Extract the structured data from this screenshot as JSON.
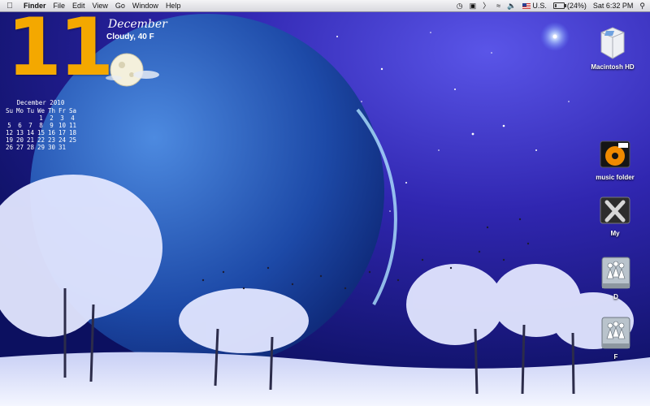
{
  "menubar": {
    "apple_icon": "apple-icon",
    "app_name": "Finder",
    "menus": [
      "File",
      "Edit",
      "View",
      "Go",
      "Window",
      "Help"
    ],
    "status": {
      "input_source": "U.S.",
      "battery": "(24%)",
      "battery_fraction": 0.24,
      "clock": "Sat 6:32 PM"
    }
  },
  "widgets": {
    "day": "11",
    "month": "December",
    "weather": "Cloudy, 40 F",
    "calendar": {
      "title": "December 2010",
      "weekdays": [
        "Su",
        "Mo",
        "Tu",
        "We",
        "Th",
        "Fr",
        "Sa"
      ],
      "weeks": [
        [
          "",
          "",
          "",
          "1",
          "2",
          "3",
          "4"
        ],
        [
          "5",
          "6",
          "7",
          "8",
          "9",
          "10",
          "11"
        ],
        [
          "12",
          "13",
          "14",
          "15",
          "16",
          "17",
          "18"
        ],
        [
          "19",
          "20",
          "21",
          "22",
          "23",
          "24",
          "25"
        ],
        [
          "26",
          "27",
          "28",
          "29",
          "30",
          "31",
          ""
        ]
      ]
    }
  },
  "desktop_icons": [
    {
      "label": "Macintosh HD",
      "icon": "hard-drive-icon"
    },
    {
      "label": "music folder",
      "icon": "music-folder-icon"
    },
    {
      "label": "My",
      "icon": "folder-x-icon"
    },
    {
      "label": "D",
      "icon": "network-drive-icon"
    },
    {
      "label": "F",
      "icon": "network-drive-icon"
    }
  ]
}
